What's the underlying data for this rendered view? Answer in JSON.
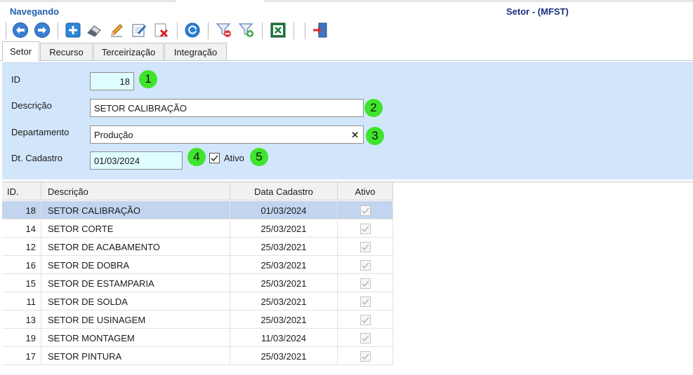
{
  "header": {
    "status": "Navegando",
    "title": "Setor - (MFST)"
  },
  "toolbar": {
    "buttons": [
      {
        "name": "previous",
        "icon": "arrow-left-icon"
      },
      {
        "name": "next",
        "icon": "arrow-right-icon"
      },
      {
        "name": "new",
        "icon": "plus-icon"
      },
      {
        "name": "clear",
        "icon": "eraser-icon"
      },
      {
        "name": "edit",
        "icon": "pencil-icon"
      },
      {
        "name": "save",
        "icon": "check-pencil-icon"
      },
      {
        "name": "delete",
        "icon": "delete-icon"
      },
      {
        "name": "refresh",
        "icon": "refresh-icon"
      },
      {
        "name": "remove-filter",
        "icon": "filter-remove-icon"
      },
      {
        "name": "add-filter",
        "icon": "filter-add-icon"
      },
      {
        "name": "export-excel",
        "icon": "excel-icon"
      },
      {
        "name": "exit",
        "icon": "exit-icon"
      }
    ]
  },
  "tabs": [
    {
      "label": "Setor",
      "active": true
    },
    {
      "label": "Recurso",
      "active": false
    },
    {
      "label": "Terceirização",
      "active": false
    },
    {
      "label": "Integração",
      "active": false
    }
  ],
  "form": {
    "id_label": "ID",
    "id_value": "18",
    "descricao_label": "Descrição",
    "descricao_value": "SETOR CALIBRAÇÃO",
    "departamento_label": "Departamento",
    "departamento_value": "Produção",
    "dtcadastro_label": "Dt. Cadastro",
    "dtcadastro_value": "01/03/2024",
    "ativo_label": "Ativo",
    "ativo_checked": true
  },
  "badges": [
    "1",
    "2",
    "3",
    "4",
    "5"
  ],
  "grid": {
    "columns": [
      "ID.",
      "Descrição",
      "Data Cadastro",
      "Ativo"
    ],
    "rows": [
      {
        "id": "18",
        "descricao": "SETOR CALIBRAÇÃO",
        "data": "01/03/2024",
        "ativo": true,
        "selected": true
      },
      {
        "id": "14",
        "descricao": "SETOR CORTE",
        "data": "25/03/2021",
        "ativo": true
      },
      {
        "id": "12",
        "descricao": "SETOR DE ACABAMENTO",
        "data": "25/03/2021",
        "ativo": true
      },
      {
        "id": "16",
        "descricao": "SETOR DE DOBRA",
        "data": "25/03/2021",
        "ativo": true
      },
      {
        "id": "15",
        "descricao": "SETOR DE ESTAMPARIA",
        "data": "25/03/2021",
        "ativo": true
      },
      {
        "id": "11",
        "descricao": "SETOR DE SOLDA",
        "data": "25/03/2021",
        "ativo": true
      },
      {
        "id": "13",
        "descricao": "SETOR DE USINAGEM",
        "data": "25/03/2021",
        "ativo": true
      },
      {
        "id": "19",
        "descricao": "SETOR MONTAGEM",
        "data": "11/03/2024",
        "ativo": true
      },
      {
        "id": "17",
        "descricao": "SETOR PINTURA",
        "data": "25/03/2021",
        "ativo": true
      }
    ]
  },
  "colors": {
    "status": "#1f5fa8",
    "title": "#1a2f7a",
    "form_bg": "#d2e6fb",
    "highlight_field": "#dffcff",
    "badge": "#3ee52c",
    "selected_row": "#c3d4ee"
  }
}
